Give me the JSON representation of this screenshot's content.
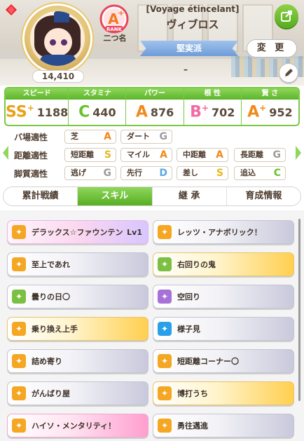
{
  "profile": {
    "fans": "14,410",
    "rank_label": "二つ名",
    "title": "[Voyage étincelant]",
    "name": "ヴィブロス",
    "style": "堅実派",
    "subtitle": "–",
    "change_label": "変 更"
  },
  "stats": [
    {
      "label": "スピード",
      "grade": "SS",
      "plus": "+",
      "value": "1188",
      "color": "#e8a21a"
    },
    {
      "label": "スタミナ",
      "grade": "C",
      "plus": "",
      "value": "440",
      "color": "#69c12c"
    },
    {
      "label": "パワー",
      "grade": "A",
      "plus": "",
      "value": "876",
      "color": "#f08a1b"
    },
    {
      "label": "根 性",
      "grade": "B",
      "plus": "+",
      "value": "702",
      "color": "#f06ba0"
    },
    {
      "label": "賢 さ",
      "grade": "A",
      "plus": "+",
      "value": "952",
      "color": "#f08a1b"
    }
  ],
  "aptitude": {
    "ground_label": "バ場適性",
    "distance_label": "距離適性",
    "style_label": "脚質適性",
    "ground": [
      {
        "name": "芝",
        "grade": "A",
        "color": "#f08a1b"
      },
      {
        "name": "ダート",
        "grade": "G",
        "color": "#9b9b9b"
      }
    ],
    "distance": [
      {
        "name": "短距離",
        "grade": "S",
        "color": "#e8b81a"
      },
      {
        "name": "マイル",
        "grade": "A",
        "color": "#f08a1b"
      },
      {
        "name": "中距離",
        "grade": "A",
        "color": "#f08a1b"
      },
      {
        "name": "長距離",
        "grade": "G",
        "color": "#9b9b9b"
      }
    ],
    "style": [
      {
        "name": "逃げ",
        "grade": "G",
        "color": "#9b9b9b"
      },
      {
        "name": "先行",
        "grade": "D",
        "color": "#5aa9e6"
      },
      {
        "name": "差し",
        "grade": "S",
        "color": "#e8b81a"
      },
      {
        "name": "追込",
        "grade": "C",
        "color": "#69c12c"
      }
    ]
  },
  "tabs": [
    "累計戦績",
    "スキル",
    "継 承",
    "育成情報"
  ],
  "skills": [
    {
      "name": "デラックス☆ファウンテン",
      "level": "Lv1",
      "style": "pink",
      "icon_color": "#f5a623"
    },
    {
      "name": "レッツ・アナボリック！",
      "level": "",
      "style": "plain",
      "icon_color": "#f5a623"
    },
    {
      "name": "至上であれ",
      "level": "",
      "style": "plain",
      "icon_color": "#f5a623"
    },
    {
      "name": "右回りの鬼",
      "level": "",
      "style": "gold",
      "icon_color": "#7bc043"
    },
    {
      "name": "曇りの日〇",
      "level": "",
      "style": "plain",
      "icon_color": "#7bc043"
    },
    {
      "name": "空回り",
      "level": "",
      "style": "plain",
      "icon_color": "#a772d8"
    },
    {
      "name": "乗り換え上手",
      "level": "",
      "style": "gold",
      "icon_color": "#f5a623"
    },
    {
      "name": "様子見",
      "level": "",
      "style": "plain",
      "icon_color": "#29a0e8"
    },
    {
      "name": "詰め寄り",
      "level": "",
      "style": "plain",
      "icon_color": "#f5a623"
    },
    {
      "name": "短距離コーナー〇",
      "level": "",
      "style": "plain",
      "icon_color": "#f5a623"
    },
    {
      "name": "がんばり屋",
      "level": "",
      "style": "plain",
      "icon_color": "#f5a623"
    },
    {
      "name": "博打うち",
      "level": "",
      "style": "gold",
      "icon_color": "#f5a623"
    },
    {
      "name": "ハイソ・メンタリティ！",
      "level": "",
      "style": "pinkhot",
      "icon_color": "#f5a623"
    },
    {
      "name": "勇往邁進",
      "level": "",
      "style": "plain",
      "icon_color": "#f5a623"
    }
  ]
}
